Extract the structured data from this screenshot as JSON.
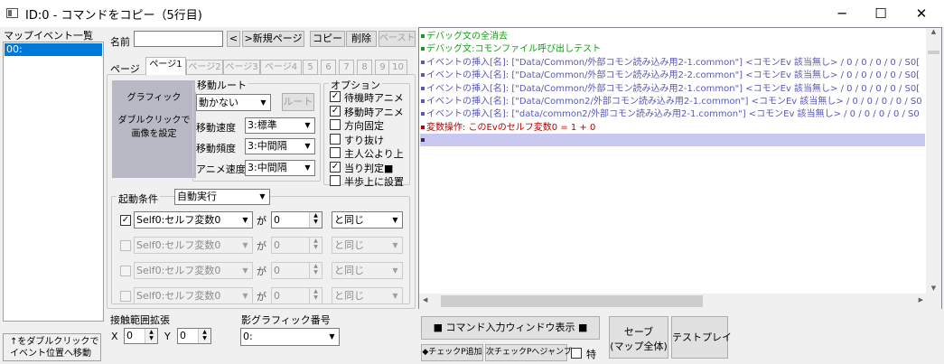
{
  "window": {
    "title": "ID:0 -  コマンドをコピー（5行目)",
    "minimize": "─",
    "maximize": "☐",
    "close": "✕"
  },
  "map_events": {
    "title": "マップイベント一覧",
    "items": [
      "00:"
    ],
    "hint_line1": "↑をダブルクリックで",
    "hint_line2": "イベント位置へ移動"
  },
  "event_header": {
    "name_label": "名前",
    "name_value": "",
    "prev": "<",
    "new_page": ">新規ページ",
    "copy": "コピー",
    "delete": "削除",
    "paste": "ペースト"
  },
  "tabs": {
    "page_label": "ページ",
    "pages": [
      "ページ1",
      "ページ2",
      "ページ3",
      "ページ4",
      "5",
      "6",
      "7",
      "8",
      "9",
      "10"
    ]
  },
  "graphic": {
    "title": "グラフィック",
    "hint_line1": "ダブルクリックで",
    "hint_line2": "画像を設定"
  },
  "movement": {
    "title": "移動ルート",
    "type_value": "動かない",
    "route_button": "ルート",
    "speed_label": "移動速度",
    "speed_value": "3:標準",
    "freq_label": "移動頻度",
    "freq_value": "3:中間隔",
    "anim_label": "アニメ速度",
    "anim_value": "3:中間隔"
  },
  "options": {
    "title": "オプション",
    "items": [
      {
        "label": "待機時アニメ",
        "checked": true
      },
      {
        "label": "移動時アニメ",
        "checked": true
      },
      {
        "label": "方向固定",
        "checked": false
      },
      {
        "label": "すり抜け",
        "checked": false
      },
      {
        "label": "主人公より上",
        "checked": false
      },
      {
        "label": "当り判定■",
        "checked": true
      },
      {
        "label": "半歩上に設置",
        "checked": false
      }
    ]
  },
  "trigger": {
    "label": "起動条件",
    "value": "自動実行",
    "conditions": [
      {
        "enabled": true,
        "variable": "Self0:セルフ変数0",
        "ga": "が",
        "value": "0",
        "op": "と同じ"
      },
      {
        "enabled": false,
        "variable": "Self0:セルフ変数0",
        "ga": "が",
        "value": "0",
        "op": "と同じ"
      },
      {
        "enabled": false,
        "variable": "Self0:セルフ変数0",
        "ga": "が",
        "value": "0",
        "op": "と同じ"
      },
      {
        "enabled": false,
        "variable": "Self0:セルフ変数0",
        "ga": "が",
        "value": "0",
        "op": "と同じ"
      }
    ]
  },
  "contact": {
    "label": "接触範囲拡張",
    "x_label": "X",
    "x_value": "0",
    "y_label": "Y",
    "y_value": "0"
  },
  "shadow": {
    "label": "影グラフィック番号",
    "value": "0:"
  },
  "commands": [
    {
      "text": "デバッグ文の全消去",
      "color": "#1a9a1a",
      "marker": "#1a9a1a"
    },
    {
      "text": "デバッグ文:コモンファイル呼び出しテスト",
      "color": "#1a9a1a",
      "marker": "#1a9a1a"
    },
    {
      "text": "イベントの挿入[名]: [\"Data/Common/外部コモン読み込み用2-1.common\"] <コモンEv 該当無し>  / 0 / 0 / 0 / 0 / S0[",
      "color": "#5959b3",
      "marker": "#5959b3"
    },
    {
      "text": "イベントの挿入[名]: [\"Data/Common/外部コモン読み込み用2-2.common\"] <コモンEv 該当無し>  / 0 / 0 / 0 / 0 / S0[",
      "color": "#5959b3",
      "marker": "#5959b3"
    },
    {
      "text": "イベントの挿入[名]: [\"Data/Common/外部コモン読み込み用2-1.common\"] <コモンEv 該当無し>  / 0 / 0 / 0 / 0 / S0[",
      "color": "#5959b3",
      "marker": "#5959b3"
    },
    {
      "text": "イベントの挿入[名]: [\"Data/Common2/外部コモン読み込み用2-1.common\"] <コモンEv 該当無し>  / 0 / 0 / 0 / 0 / S0",
      "color": "#5959b3",
      "marker": "#5959b3"
    },
    {
      "text": "イベントの挿入[名]: [\"data/common2/外部コモン読み込み用2-1.common\"] <コモンEv 該当無し>  / 0 / 0 / 0 / 0 / S0",
      "color": "#5959b3",
      "marker": "#5959b3"
    },
    {
      "text": "変数操作: このEvのセルフ変数0 = 1 + 0",
      "color": "#b40000",
      "marker": "#b40000"
    },
    {
      "text": "",
      "color": "#000000",
      "marker": "#2b2b6b"
    }
  ],
  "bottom": {
    "command_input": "■  コマンド入力ウィンドウ表示  ■",
    "save_line1": "セーブ",
    "save_line2": "(マップ全体)",
    "test_play": "テストプレイ",
    "check_add": "◆チェックP追加",
    "next_check": "次チェックPへジャンプ",
    "special": "特"
  },
  "colors": {
    "selection": "#0078d7",
    "highlight_row": "#c8c8f0",
    "graphic_bg": "#b9b9c6"
  }
}
